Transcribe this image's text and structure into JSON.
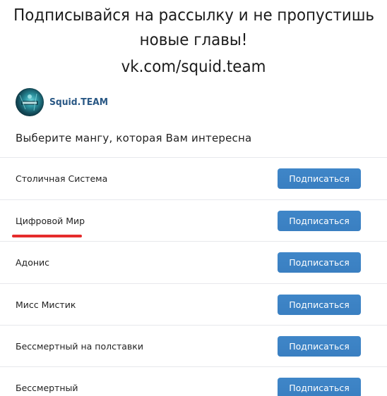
{
  "banner": {
    "line1": "Подписывайся на рассылку и не пропустишь",
    "line2": "новые главы!",
    "line3": "vk.com/squid.team"
  },
  "group": {
    "name": "Squid.TEAM",
    "avatar_icon": "squid-team-avatar"
  },
  "prompt": "Выберите мангу, которая Вам интересна",
  "subscriptions": [
    {
      "title": "Столичная Система",
      "button": "Подписаться"
    },
    {
      "title": "Цифровой Мир",
      "button": "Подписаться"
    },
    {
      "title": "Адонис",
      "button": "Подписаться"
    },
    {
      "title": "Мисс Мистик",
      "button": "Подписаться"
    },
    {
      "title": "Бессмертный на полставки",
      "button": "Подписаться"
    },
    {
      "title": "Бессмертный",
      "button": "Подписаться"
    }
  ],
  "colors": {
    "accent": "#3f86c8",
    "link": "#2a5885",
    "highlight": "#e52b2b"
  }
}
